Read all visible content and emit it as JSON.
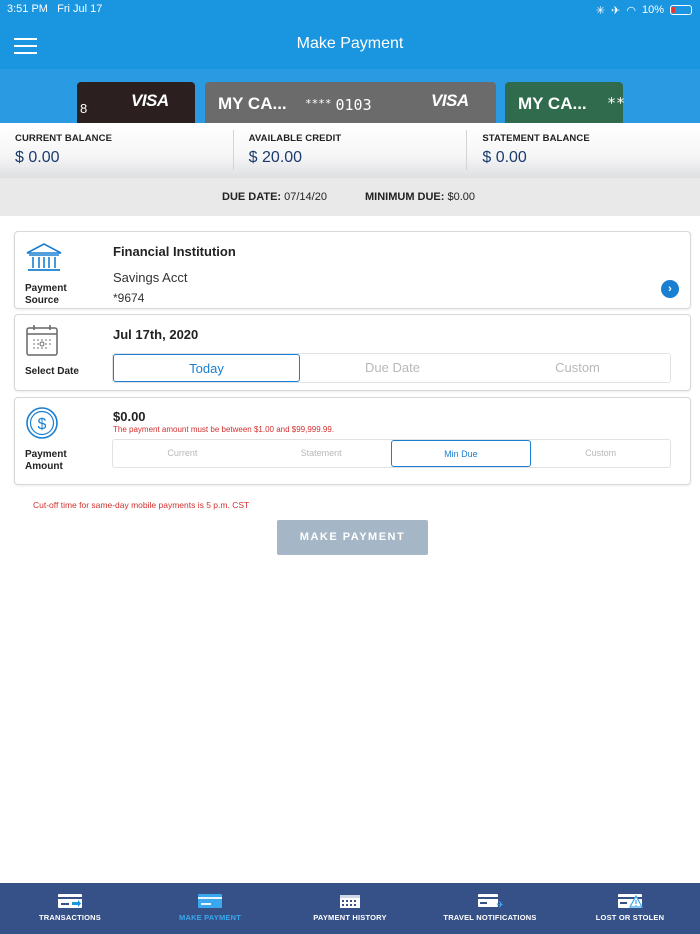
{
  "status_bar": {
    "time": "3:51 PM",
    "date": "Fri Jul 17",
    "battery": "10%"
  },
  "header": {
    "title": "Make Payment"
  },
  "cards": [
    {
      "partial_text": "8",
      "brand": "VISA"
    },
    {
      "name": "MY CA...",
      "masked": "****",
      "last4": "0103",
      "brand": "VISA"
    },
    {
      "name": "MY CA...",
      "masked": "**"
    }
  ],
  "balances": {
    "current": {
      "label": "CURRENT BALANCE",
      "value": "$ 0.00"
    },
    "available": {
      "label": "AVAILABLE CREDIT",
      "value": "$ 20.00"
    },
    "statement": {
      "label": "STATEMENT BALANCE",
      "value": "$ 0.00"
    }
  },
  "due": {
    "date_label": "DUE DATE:",
    "date_value": "07/14/20",
    "min_label": "MINIMUM DUE:",
    "min_value": "$0.00"
  },
  "payment_source": {
    "label": "Payment Source",
    "institution": "Financial Institution",
    "account": "Savings Acct",
    "number": "*9674"
  },
  "select_date": {
    "label": "Select Date",
    "date": "Jul 17th, 2020",
    "options": [
      "Today",
      "Due Date",
      "Custom"
    ],
    "selected": "Today"
  },
  "payment_amount": {
    "label": "Payment Amount",
    "amount": "$0.00",
    "error": "The payment amount must be between $1.00 and $99,999.99.",
    "options": [
      "Current",
      "Statement",
      "Min Due",
      "Custom"
    ],
    "selected": "Min Due"
  },
  "cutoff_note": "Cut-off time for same-day mobile payments is 5 p.m. CST",
  "make_payment_button": "MAKE PAYMENT",
  "tabs": [
    {
      "label": "TRANSACTIONS",
      "icon": "transactions-card-icon"
    },
    {
      "label": "MAKE PAYMENT",
      "icon": "payment-card-icon",
      "active": true
    },
    {
      "label": "PAYMENT HISTORY",
      "icon": "calendar-history-icon"
    },
    {
      "label": "TRAVEL NOTIFICATIONS",
      "icon": "travel-card-icon"
    },
    {
      "label": "LOST OR STOLEN",
      "icon": "warning-card-icon"
    }
  ],
  "colors": {
    "header": "#1a95e0",
    "accent": "#1a7fd1",
    "tabbar": "#365188",
    "error": "#d32f2f",
    "button": "#a5b6c6"
  }
}
